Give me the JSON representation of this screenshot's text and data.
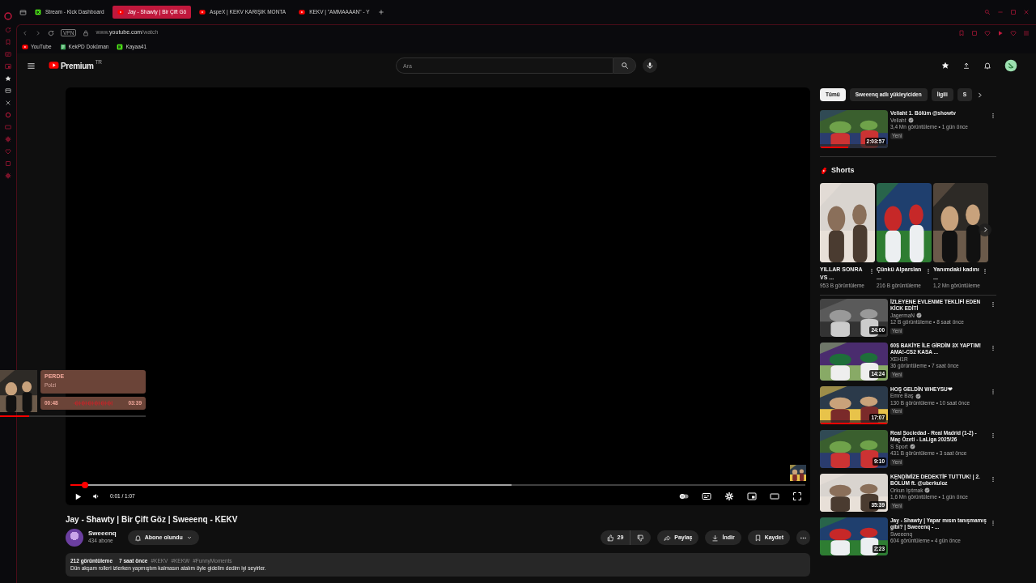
{
  "browser": {
    "tabs": [
      {
        "title": "Stream - Kick Dashboard",
        "selected": false,
        "kind": "kick"
      },
      {
        "title": "Jay - Shawty | Bir Çift Gö",
        "selected": true,
        "kind": "youtube"
      },
      {
        "title": "AspeX | KEKV KARIŞIK MONTA",
        "selected": false,
        "kind": "youtube"
      },
      {
        "title": "KEKV | \"AMMAAAAN\" - Y",
        "selected": false,
        "kind": "youtube"
      }
    ],
    "vpn": "VPN",
    "url_prefix": "www.",
    "url_host": "youtube.com",
    "url_path": "/watch",
    "bookmarks": [
      {
        "label": "YouTube",
        "kind": "youtube"
      },
      {
        "label": "KekPD Doküman",
        "kind": "doc"
      },
      {
        "label": "Kayaa41",
        "kind": "kick"
      }
    ]
  },
  "header": {
    "logo": "Premium",
    "region": "TR",
    "search_placeholder": "Ara"
  },
  "player": {
    "progress": {
      "level": 0.02
    },
    "buffer": {
      "level": 0.6
    },
    "time": "0:01 / 1:07"
  },
  "video": {
    "title": "Jay - Shawty | Bir Çift Göz | Sweeenq - KEKV",
    "channel": "Sweeenq",
    "subscribers": "434 abone",
    "subscribe_label": "Abone olundu",
    "likes": "29",
    "share": "Paylaş",
    "download": "İndir",
    "save": "Kaydet",
    "views": "212 görüntüleme",
    "age": "7 saat önce",
    "hashtags": [
      "#KEKV",
      "#KEKW",
      "#FunnyMoments"
    ],
    "description": "Dün akşam rolleri izlerken yapmıştım kalmasın atalım öyle gidelim dedim iyi seyirler."
  },
  "mini_player": {
    "title": "PERDE",
    "artist": "Polzi",
    "elapsed": "00:48",
    "total": "03:39",
    "progress": {
      "level": 0.2
    }
  },
  "chips": [
    {
      "label": "Tümü",
      "selected": true
    },
    {
      "label": "Sweeenq adlı yükleyiciden",
      "selected": false
    },
    {
      "label": "İlgili",
      "selected": false
    },
    {
      "label": "S",
      "selected": false
    }
  ],
  "top_recommendations": [
    {
      "title": "Veliaht 1. Bölüm @showtv",
      "channel": "Veliaht",
      "verified": true,
      "meta": "3,4 Mn görüntüleme • 1 gün önce",
      "badge": "Yeni",
      "duration": "2:03:57",
      "watched": {
        "level": 0.42
      }
    }
  ],
  "shorts": {
    "title": "Shorts",
    "items": [
      {
        "title": "YILLAR SONRA VS ...",
        "views": "953 B görüntüleme"
      },
      {
        "title": "Çünkü Alparslan ...",
        "views": "216 B görüntüleme"
      },
      {
        "title": "Yanımdaki kadını ...",
        "views": "1,2 Mn görüntüleme"
      }
    ]
  },
  "recommendations": [
    {
      "title": "İZLEYENE EVLENME TEKLİFİ EDEN KİCK EDİTİ",
      "channel": "JagermaN",
      "verified": true,
      "meta": "12 B görüntüleme • 8 saat önce",
      "badge": "Yeni",
      "duration": "24:00"
    },
    {
      "title": "60$ BAKİYE İLE GİRDİM 3X YAPTIM! AMA!-CS2 KASA ...",
      "channel": "XEH1R",
      "verified": false,
      "meta": "36 görüntüleme • 7 saat önce",
      "badge": "Yeni",
      "duration": "14:24"
    },
    {
      "title": "HOŞ GELDİN WHEYSU❤",
      "channel": "Emre Baş",
      "verified": true,
      "meta": "130 B görüntüleme • 10 saat önce",
      "badge": "Yeni",
      "duration": "17:07",
      "watched": {
        "level": 1
      }
    },
    {
      "title": "Real Sociedad - Real Madrid (1-2) - Maç Özeti - LaLiga 2025/26",
      "channel": "S Sport",
      "verified": true,
      "meta": "431 B görüntüleme • 3 saat önce",
      "badge": "Yeni",
      "duration": "9:10"
    },
    {
      "title": "KENDİMİZE DEDEKTİF TUTTUK! | 2. BÖLÜM  ft. @uberkuloz",
      "channel": "Orkun Işıtmak",
      "verified": true,
      "meta": "1,6 Mn görüntüleme • 1 gün önce",
      "badge": "Yeni",
      "duration": "35:39"
    },
    {
      "title": "Jay - Shawty | Yapar mısın tanışmamış gibi? | Sweeenq - ...",
      "channel": "Sweeenq",
      "verified": false,
      "meta": "604 görüntüleme • 4 gün önce",
      "duration": "2:23"
    }
  ]
}
